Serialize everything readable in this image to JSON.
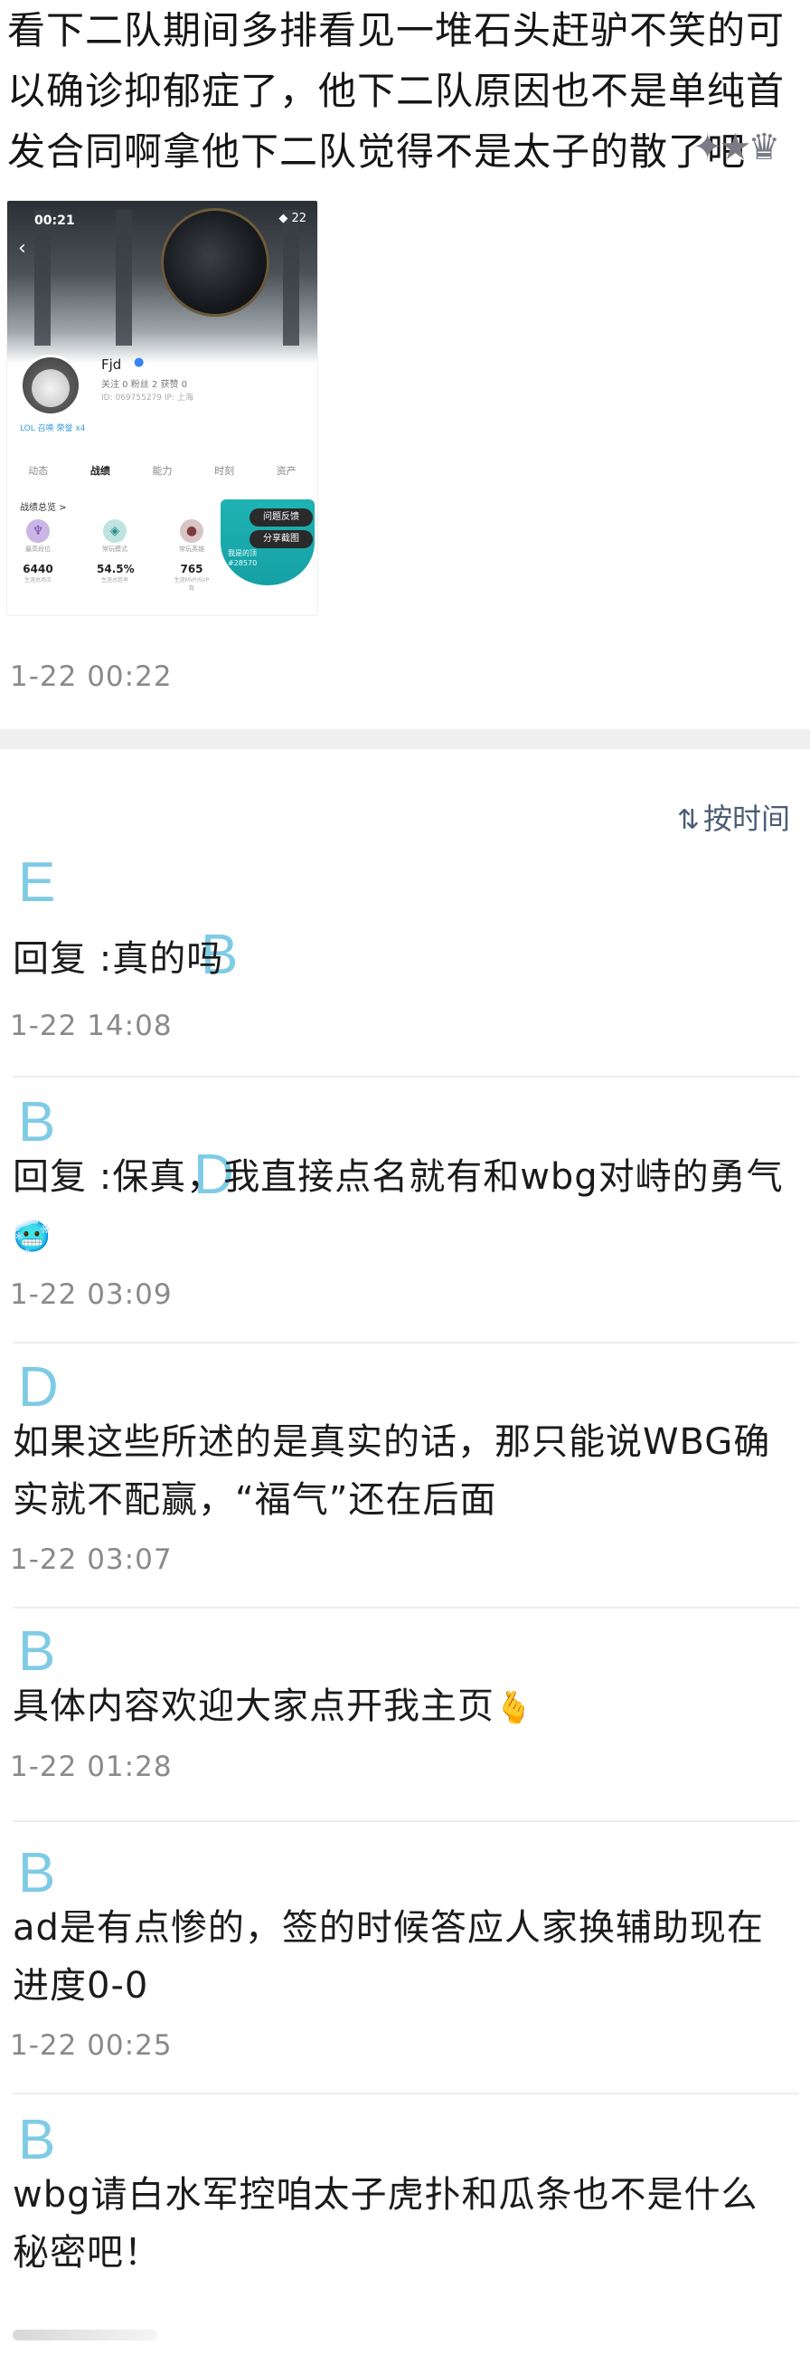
{
  "post": {
    "text": "看下二队期间多排看见一堆石头赶驴不笑的可以确诊抑郁症了，他下二队原因也不是单纯首发合同啊拿他下二队觉得不是太子的散了吧",
    "timestamp": "1-22 00:22"
  },
  "screenshot": {
    "status_time": "00:21",
    "status_icons": "◆ 22",
    "name": "Fjd",
    "stats": "关注 0   粉丝 2   获赞 0",
    "id_line": "ID: 069755279  IP: 上海",
    "tags": "LOL   召唤   荣誉 x4",
    "tabs": [
      "动态",
      "战绩",
      "能力",
      "时刻",
      "资产"
    ],
    "summary_title": "战绩总览 >",
    "items": [
      {
        "label": "最高段位",
        "value": "6440",
        "sub": "生涯总场次"
      },
      {
        "label": "常玩模式",
        "value": "54.5%",
        "sub": "生涯总胜率"
      },
      {
        "label": "常玩英雄",
        "value": "765",
        "sub": "生涯MVP/SVP数"
      }
    ],
    "btn_feedback": "问题反馈",
    "btn_share": "分享截图",
    "side_text": "我是的顶\n#28570"
  },
  "sort": {
    "label": "按时间",
    "icon": "sort-icon"
  },
  "comments": [
    {
      "name": "E",
      "text": "回复                    :真的吗",
      "inline_name": "B",
      "timestamp": "1-22 14:08"
    },
    {
      "name": "B",
      "text": "回复                    :保真，我直接点名就有和wbg对峙的勇气",
      "inline_name": "D",
      "emoji": "🥶",
      "timestamp": "1-22 03:09"
    },
    {
      "name": "D",
      "text": "如果这些所述的是真实的话，那只能说WBG确实就不配赢，“福气”还在后面",
      "timestamp": "1-22 03:07"
    },
    {
      "name": "B",
      "text": "具体内容欢迎大家点开我主页",
      "emoji": "🫰",
      "timestamp": "1-22 01:28"
    },
    {
      "name": "B",
      "text": "ad是有点惨的，签的时候答应人家换辅助现在进度0-0",
      "timestamp": "1-22 00:25"
    },
    {
      "name": "B",
      "text": "wbg请白水军控咱太子虎扑和瓜条也不是什么秘密吧！"
    }
  ]
}
